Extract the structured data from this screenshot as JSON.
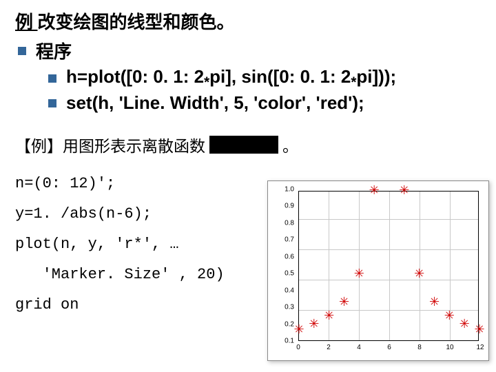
{
  "title": {
    "lead": "例  ",
    "rest": "改变绘图的线型和颜色。"
  },
  "program_label": "程序",
  "code_line1": "h=plot([0: 0. 1: 2",
  "code_line1b": "pi], sin([0: 0. 1: 2",
  "code_line1c": "pi]));",
  "star": "*",
  "code_line2": "set(h, 'Line. Width', 5, 'color', 'red');",
  "section2_pre": "【例】用图形表示离散函数 ",
  "section2_post": " 。",
  "code_block": {
    "l1": "n=(0: 12)';",
    "l2": "y=1. /abs(n-6);",
    "l3": "plot(n, y, 'r*', …",
    "l4": "   'Marker. Size' , 20)",
    "l5": "grid on"
  },
  "chart_data": {
    "type": "scatter",
    "x": [
      0,
      1,
      2,
      3,
      4,
      5,
      6,
      7,
      8,
      9,
      10,
      11,
      12
    ],
    "y": [
      0.167,
      0.2,
      0.25,
      0.333,
      0.5,
      1.0,
      null,
      1.0,
      0.5,
      0.333,
      0.25,
      0.2,
      0.167
    ],
    "title": "",
    "xlabel": "",
    "ylabel": "",
    "xlim": [
      0,
      12
    ],
    "ylim": [
      0.1,
      1.0
    ],
    "xticks": [
      0,
      2,
      4,
      6,
      8,
      10,
      12
    ],
    "yticks": [
      0.1,
      0.2,
      0.3,
      0.4,
      0.5,
      0.6,
      0.7,
      0.8,
      0.9,
      1.0
    ],
    "marker": "*",
    "marker_color": "red",
    "grid": true
  }
}
